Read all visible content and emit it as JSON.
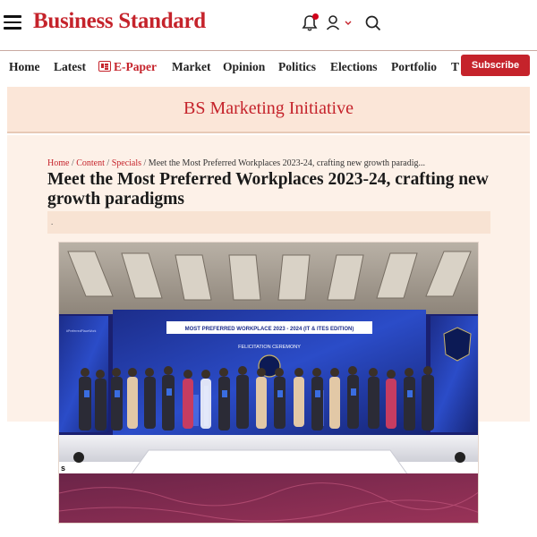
{
  "header": {
    "logo_text": "Business Standard",
    "brand_color": "#c5232b",
    "icons": [
      "menu-icon",
      "bell-icon",
      "user-icon",
      "chevron-down-icon",
      "search-icon"
    ]
  },
  "nav": {
    "items": [
      "Home",
      "Latest",
      "E-Paper",
      "Market",
      "Opinion",
      "Politics",
      "Elections",
      "Portfolio",
      "T"
    ],
    "subscribe_label": "Subscribe"
  },
  "banner": {
    "title": "BS Marketing Initiative"
  },
  "breadcrumb": {
    "items": [
      "Home",
      "Content",
      "Specials"
    ],
    "current": "Meet the Most Preferred Workplaces 2023-24, crafting new growth paradig..."
  },
  "article": {
    "headline": "Meet the Most Preferred Workplaces 2023-24, crafting new growth paradigms",
    "summary": "."
  },
  "hero_image": {
    "stage_banner_title": "MOST PREFERRED WORKPLACE 2023 - 2024 (IT & ITES EDITION)",
    "stage_banner_subtitle": "FELICITATION CEREMONY",
    "badge_text": "MOST PREFERRED WORKPLACE",
    "left_caption": "#PreferredPlaceWork",
    "bottom_fragment": "s"
  }
}
